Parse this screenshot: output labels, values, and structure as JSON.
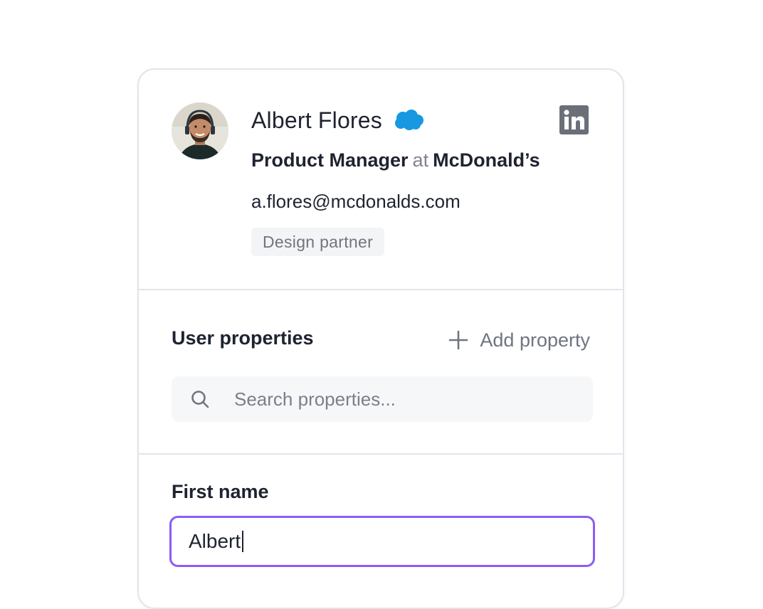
{
  "contact": {
    "name": "Albert Flores",
    "role": "Product Manager",
    "at": "at",
    "company": "McDonald’s",
    "email": "a.flores@mcdonalds.com",
    "tag": "Design partner",
    "crm_icon": "salesforce-cloud-icon",
    "social_icon": "linkedin-icon"
  },
  "properties": {
    "title": "User properties",
    "add_label": "Add property",
    "search_placeholder": "Search properties..."
  },
  "field": {
    "label": "First name",
    "value": "Albert"
  },
  "colors": {
    "accent_focus": "#8b5cf6",
    "salesforce": "#1798e0",
    "linkedin_bg": "#6b6f78",
    "text": "#1f2330",
    "muted": "#6f7480"
  }
}
